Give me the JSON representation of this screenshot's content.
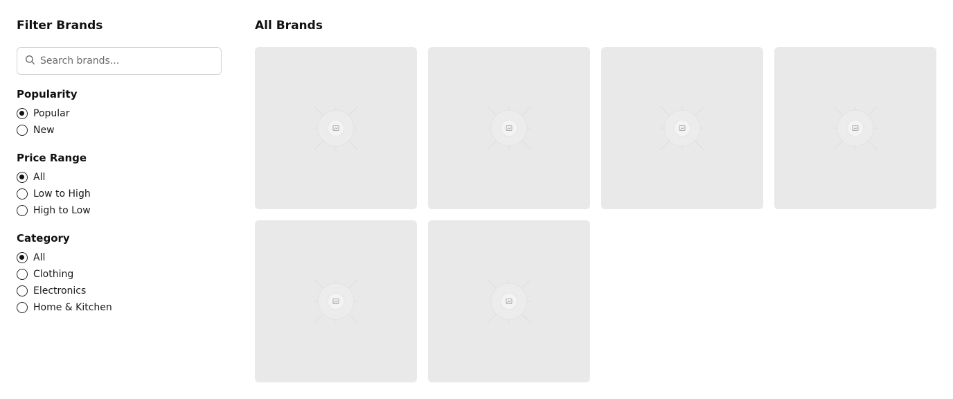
{
  "sidebar": {
    "title": "Filter Brands",
    "search": {
      "placeholder": "Search brands...",
      "value": "",
      "icon": "search-icon"
    },
    "groups": [
      {
        "title": "Popularity",
        "options": [
          {
            "label": "Popular",
            "checked": true
          },
          {
            "label": "New",
            "checked": false
          }
        ]
      },
      {
        "title": "Price Range",
        "options": [
          {
            "label": "All",
            "checked": true
          },
          {
            "label": "Low to High",
            "checked": false
          },
          {
            "label": "High to Low",
            "checked": false
          }
        ]
      },
      {
        "title": "Category",
        "options": [
          {
            "label": "All",
            "checked": true
          },
          {
            "label": "Clothing",
            "checked": false
          },
          {
            "label": "Electronics",
            "checked": false
          },
          {
            "label": "Home & Kitchen",
            "checked": false
          }
        ]
      }
    ]
  },
  "main": {
    "title": "All Brands",
    "cards": [
      {
        "icon": "image-placeholder-icon"
      },
      {
        "icon": "image-placeholder-icon"
      },
      {
        "icon": "image-placeholder-icon"
      },
      {
        "icon": "image-placeholder-icon"
      },
      {
        "icon": "image-placeholder-icon"
      },
      {
        "icon": "image-placeholder-icon"
      }
    ]
  },
  "colors": {
    "card_background": "#e9e9e9",
    "text": "#111111",
    "border": "#d4d4d4"
  }
}
